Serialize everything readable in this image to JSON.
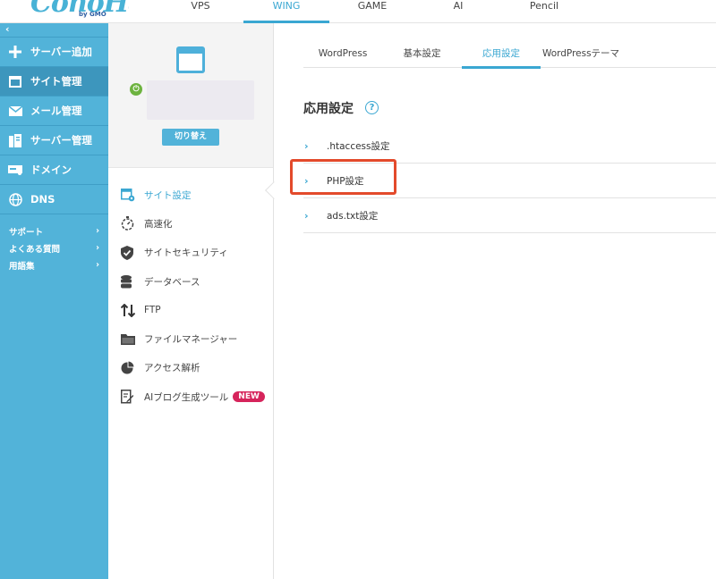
{
  "header": {
    "logo": "ConoHa",
    "logo_sub": "by GMO",
    "nav": [
      {
        "label": "VPS"
      },
      {
        "label": "WING"
      },
      {
        "label": "GAME"
      },
      {
        "label": "AI"
      },
      {
        "label": "Pencil"
      }
    ],
    "active_nav": "WING"
  },
  "sidebar": {
    "collapse_glyph": "‹",
    "items": [
      {
        "label": "サーバー追加",
        "icon": "plus-icon"
      },
      {
        "label": "サイト管理",
        "icon": "window-icon"
      },
      {
        "label": "メール管理",
        "icon": "mail-icon"
      },
      {
        "label": "サーバー管理",
        "icon": "server-icon"
      },
      {
        "label": "ドメイン",
        "icon": "domain-icon"
      },
      {
        "label": "DNS",
        "icon": "globe-icon"
      }
    ],
    "active_item": "サイト管理",
    "links": [
      {
        "label": "サポート"
      },
      {
        "label": "よくある質問"
      },
      {
        "label": "用語集"
      }
    ]
  },
  "site_panel": {
    "switch_button": "切り替え"
  },
  "site_menu": {
    "items": [
      {
        "label": "サイト設定",
        "icon": "site-settings-icon"
      },
      {
        "label": "高速化",
        "icon": "stopwatch-icon"
      },
      {
        "label": "サイトセキュリティ",
        "icon": "shield-check-icon"
      },
      {
        "label": "データベース",
        "icon": "database-icon"
      },
      {
        "label": "FTP",
        "icon": "transfer-arrows-icon"
      },
      {
        "label": "ファイルマネージャー",
        "icon": "folder-icon"
      },
      {
        "label": "アクセス解析",
        "icon": "pie-chart-icon"
      },
      {
        "label": "AIブログ生成ツール",
        "icon": "edit-document-icon"
      }
    ],
    "active_item": "サイト設定",
    "new_badge": "NEW"
  },
  "tabs": [
    {
      "label": "WordPress"
    },
    {
      "label": "基本設定"
    },
    {
      "label": "応用設定"
    },
    {
      "label": "WordPressテーマ"
    }
  ],
  "active_tab": "応用設定",
  "main": {
    "title": "応用設定",
    "help_glyph": "?",
    "settings": [
      {
        "label": ".htaccess設定"
      },
      {
        "label": "PHP設定"
      },
      {
        "label": "ads.txt設定"
      }
    ],
    "highlighted_setting": "PHP設定"
  },
  "colors": {
    "accent": "#3aa7d2",
    "sidebar": "#52b3d9",
    "highlight_box": "#e34a2b",
    "new_badge": "#d6245b"
  }
}
